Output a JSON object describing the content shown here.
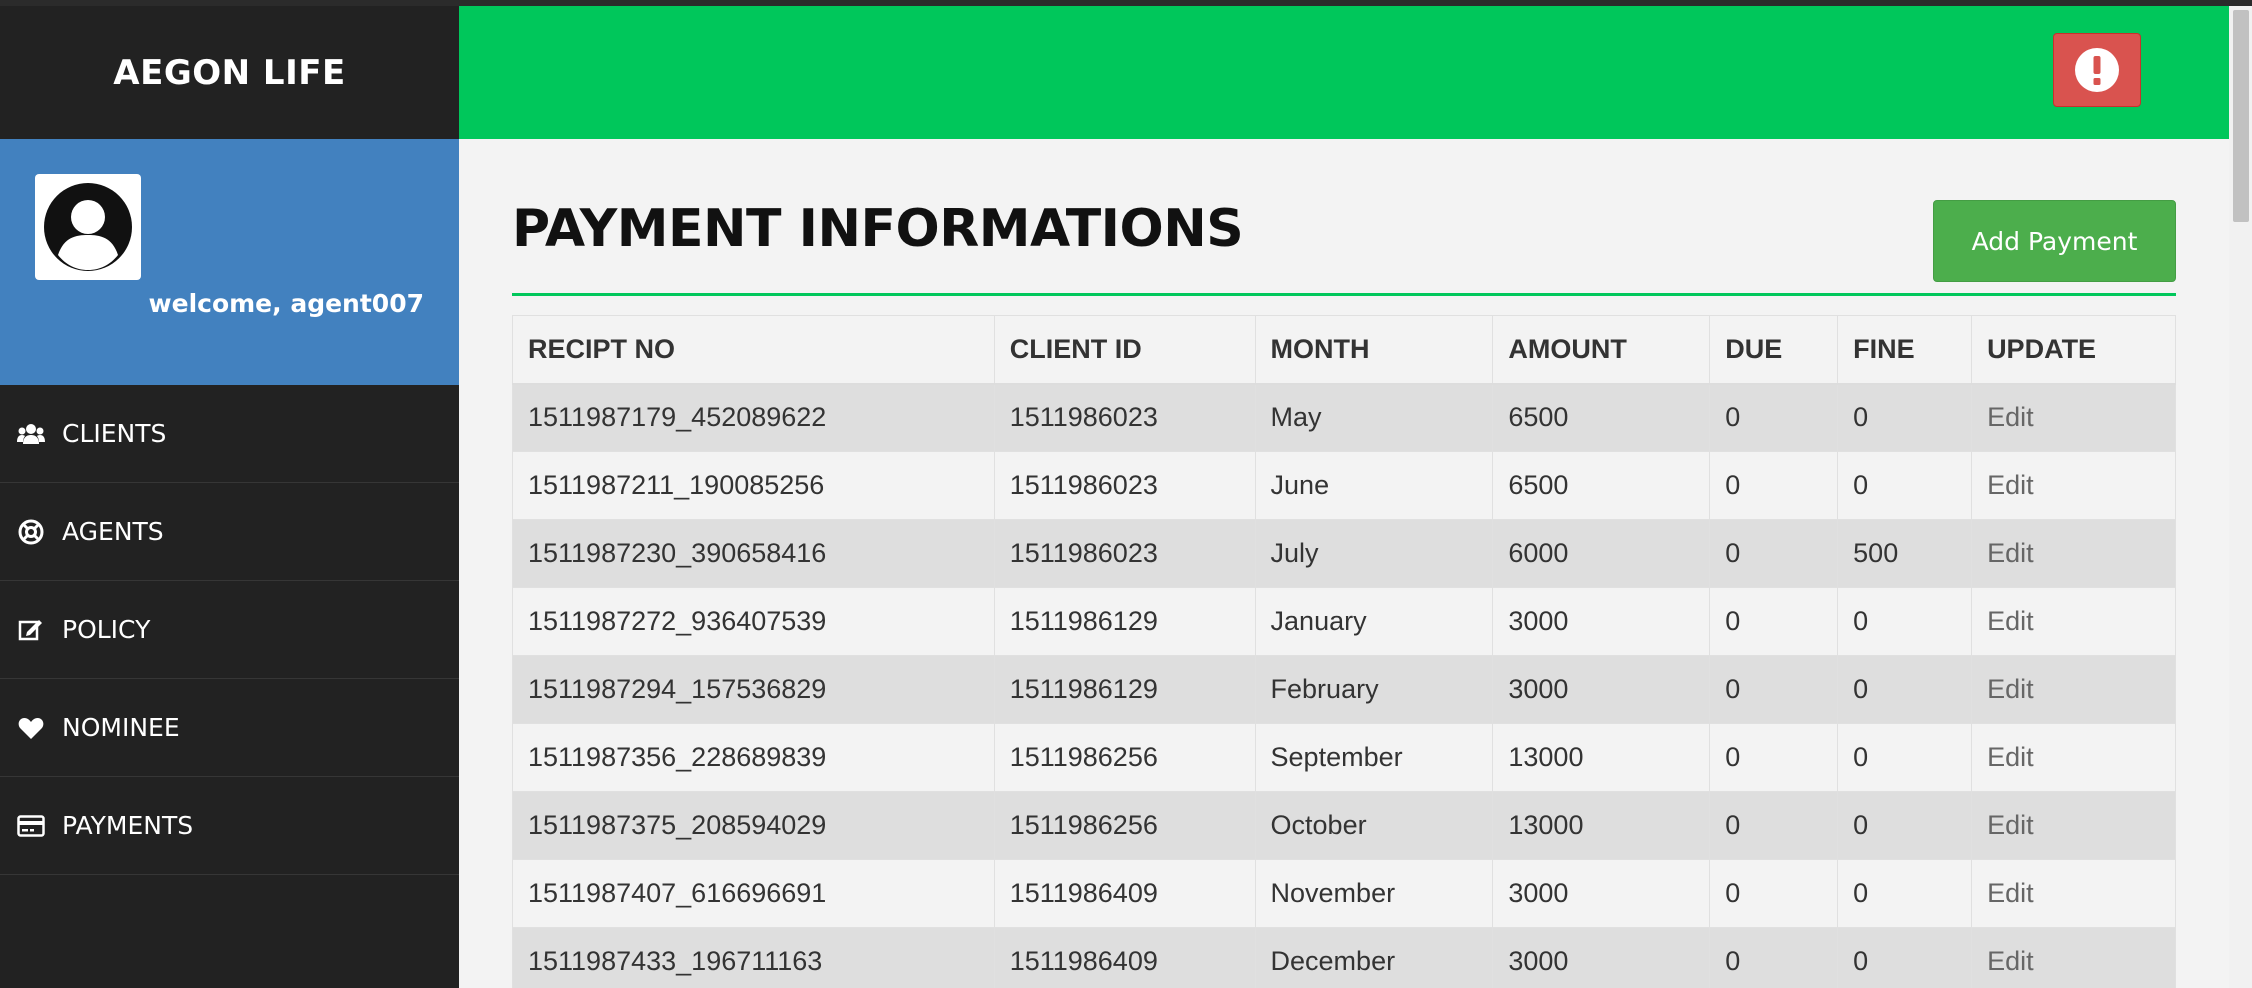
{
  "app": {
    "brand": "AEGON LIFE",
    "welcome_text": "welcome, agent007"
  },
  "sidebar": {
    "items": [
      {
        "label": "CLIENTS",
        "icon": "users-icon"
      },
      {
        "label": "AGENTS",
        "icon": "life-ring-icon"
      },
      {
        "label": "POLICY",
        "icon": "edit-icon"
      },
      {
        "label": "NOMINEE",
        "icon": "heart-icon"
      },
      {
        "label": "PAYMENTS",
        "icon": "credit-card-icon"
      }
    ]
  },
  "header": {
    "alert_icon": "exclamation-circle-icon"
  },
  "main": {
    "title": "PAYMENT INFORMATIONS",
    "add_button_label": "Add Payment",
    "table": {
      "columns": [
        "RECIPT NO",
        "CLIENT ID",
        "MONTH",
        "AMOUNT",
        "DUE",
        "FINE",
        "UPDATE"
      ],
      "rows": [
        [
          "1511987179_452089622",
          "1511986023",
          "May",
          "6500",
          "0",
          "0",
          "Edit"
        ],
        [
          "1511987211_190085256",
          "1511986023",
          "June",
          "6500",
          "0",
          "0",
          "Edit"
        ],
        [
          "1511987230_390658416",
          "1511986023",
          "July",
          "6000",
          "0",
          "500",
          "Edit"
        ],
        [
          "1511987272_936407539",
          "1511986129",
          "January",
          "3000",
          "0",
          "0",
          "Edit"
        ],
        [
          "1511987294_157536829",
          "1511986129",
          "February",
          "3000",
          "0",
          "0",
          "Edit"
        ],
        [
          "1511987356_228689839",
          "1511986256",
          "September",
          "13000",
          "0",
          "0",
          "Edit"
        ],
        [
          "1511987375_208594029",
          "1511986256",
          "October",
          "13000",
          "0",
          "0",
          "Edit"
        ],
        [
          "1511987407_616696691",
          "1511986409",
          "November",
          "3000",
          "0",
          "0",
          "Edit"
        ],
        [
          "1511987433_196711163",
          "1511986409",
          "December",
          "3000",
          "0",
          "0",
          "Edit"
        ]
      ]
    }
  },
  "colors": {
    "header_green": "#00c75b",
    "sidebar_dark": "#222222",
    "profile_blue": "#4281bf",
    "alert_red": "#d9534f",
    "button_green": "#4cae4c"
  }
}
